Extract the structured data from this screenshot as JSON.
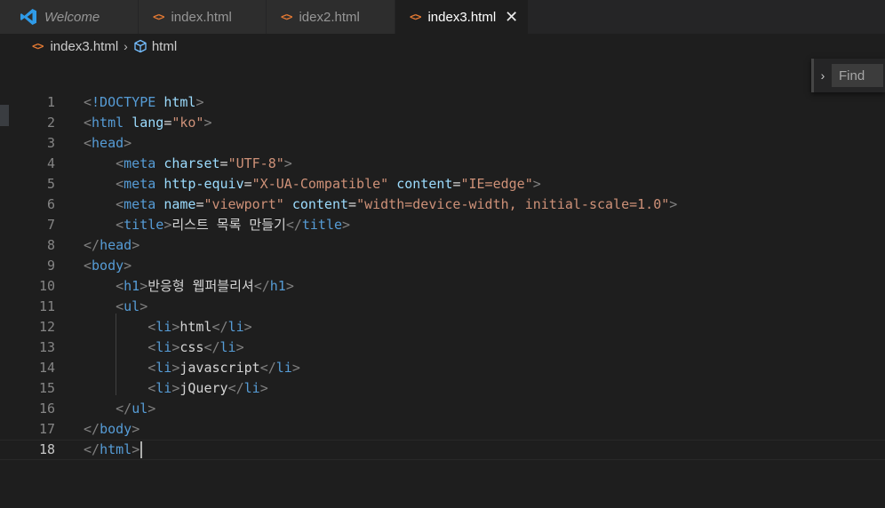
{
  "tabs": [
    {
      "label": "Welcome",
      "icon": "vscode-logo-icon",
      "italic": true,
      "active": false
    },
    {
      "label": "index.html",
      "icon": "html-file-icon",
      "active": false
    },
    {
      "label": "idex2.html",
      "icon": "html-file-icon",
      "active": false
    },
    {
      "label": "index3.html",
      "icon": "html-file-icon",
      "active": true,
      "close": "✕"
    }
  ],
  "breadcrumb": {
    "file": "index3.html",
    "separator": "›",
    "symbol": "html"
  },
  "find": {
    "chevron": "›",
    "placeholder": "Find"
  },
  "colors": {
    "editor_bg": "#1e1e1e",
    "tag": "#569cd6",
    "attribute": "#9cdcfe",
    "string": "#ce9178",
    "punctuation": "#808080",
    "text": "#d4d4d4",
    "line_number": "#858585",
    "html_icon": "#e37933",
    "vscode_blue": "#0078d4"
  },
  "editor": {
    "current_line": 18,
    "lines": [
      {
        "n": "1",
        "tokens": [
          [
            "pn",
            "<"
          ],
          [
            "tg",
            "!DOCTYPE "
          ],
          [
            "at",
            "html"
          ],
          [
            "pn",
            ">"
          ]
        ]
      },
      {
        "n": "2",
        "tokens": [
          [
            "pn",
            "<"
          ],
          [
            "tg",
            "html"
          ],
          [
            "tx",
            " "
          ],
          [
            "at",
            "lang"
          ],
          [
            "tx",
            "="
          ],
          [
            "st",
            "\"ko\""
          ],
          [
            "pn",
            ">"
          ]
        ]
      },
      {
        "n": "3",
        "tokens": [
          [
            "pn",
            "<"
          ],
          [
            "tg",
            "head"
          ],
          [
            "pn",
            ">"
          ]
        ]
      },
      {
        "n": "4",
        "tokens": [
          [
            "tx",
            "    "
          ],
          [
            "pn",
            "<"
          ],
          [
            "tg",
            "meta"
          ],
          [
            "tx",
            " "
          ],
          [
            "at",
            "charset"
          ],
          [
            "tx",
            "="
          ],
          [
            "st",
            "\"UTF-8\""
          ],
          [
            "pn",
            ">"
          ]
        ]
      },
      {
        "n": "5",
        "tokens": [
          [
            "tx",
            "    "
          ],
          [
            "pn",
            "<"
          ],
          [
            "tg",
            "meta"
          ],
          [
            "tx",
            " "
          ],
          [
            "at",
            "http-equiv"
          ],
          [
            "tx",
            "="
          ],
          [
            "st",
            "\"X-UA-Compatible\""
          ],
          [
            "tx",
            " "
          ],
          [
            "at",
            "content"
          ],
          [
            "tx",
            "="
          ],
          [
            "st",
            "\"IE=edge\""
          ],
          [
            "pn",
            ">"
          ]
        ]
      },
      {
        "n": "6",
        "tokens": [
          [
            "tx",
            "    "
          ],
          [
            "pn",
            "<"
          ],
          [
            "tg",
            "meta"
          ],
          [
            "tx",
            " "
          ],
          [
            "at",
            "name"
          ],
          [
            "tx",
            "="
          ],
          [
            "st",
            "\"viewport\""
          ],
          [
            "tx",
            " "
          ],
          [
            "at",
            "content"
          ],
          [
            "tx",
            "="
          ],
          [
            "st",
            "\"width=device-width, initial-scale=1.0\""
          ],
          [
            "pn",
            ">"
          ]
        ]
      },
      {
        "n": "7",
        "tokens": [
          [
            "tx",
            "    "
          ],
          [
            "pn",
            "<"
          ],
          [
            "tg",
            "title"
          ],
          [
            "pn",
            ">"
          ],
          [
            "tx",
            "리스트 목록 만들기"
          ],
          [
            "pn",
            "</"
          ],
          [
            "tg",
            "title"
          ],
          [
            "pn",
            ">"
          ]
        ]
      },
      {
        "n": "8",
        "tokens": [
          [
            "pn",
            "</"
          ],
          [
            "tg",
            "head"
          ],
          [
            "pn",
            ">"
          ]
        ]
      },
      {
        "n": "9",
        "tokens": [
          [
            "pn",
            "<"
          ],
          [
            "tg",
            "body"
          ],
          [
            "pn",
            ">"
          ]
        ]
      },
      {
        "n": "10",
        "tokens": [
          [
            "tx",
            "    "
          ],
          [
            "pn",
            "<"
          ],
          [
            "tg",
            "h1"
          ],
          [
            "pn",
            ">"
          ],
          [
            "tx",
            "반응형 웹퍼블리셔"
          ],
          [
            "pn",
            "</"
          ],
          [
            "tg",
            "h1"
          ],
          [
            "pn",
            ">"
          ]
        ]
      },
      {
        "n": "11",
        "tokens": [
          [
            "tx",
            "    "
          ],
          [
            "pn",
            "<"
          ],
          [
            "tg",
            "ul"
          ],
          [
            "pn",
            ">"
          ]
        ]
      },
      {
        "n": "12",
        "tokens": [
          [
            "tx",
            "        "
          ],
          [
            "pn",
            "<"
          ],
          [
            "tg",
            "li"
          ],
          [
            "pn",
            ">"
          ],
          [
            "tx",
            "html"
          ],
          [
            "pn",
            "</"
          ],
          [
            "tg",
            "li"
          ],
          [
            "pn",
            ">"
          ]
        ]
      },
      {
        "n": "13",
        "tokens": [
          [
            "tx",
            "        "
          ],
          [
            "pn",
            "<"
          ],
          [
            "tg",
            "li"
          ],
          [
            "pn",
            ">"
          ],
          [
            "tx",
            "css"
          ],
          [
            "pn",
            "</"
          ],
          [
            "tg",
            "li"
          ],
          [
            "pn",
            ">"
          ]
        ]
      },
      {
        "n": "14",
        "tokens": [
          [
            "tx",
            "        "
          ],
          [
            "pn",
            "<"
          ],
          [
            "tg",
            "li"
          ],
          [
            "pn",
            ">"
          ],
          [
            "tx",
            "javascript"
          ],
          [
            "pn",
            "</"
          ],
          [
            "tg",
            "li"
          ],
          [
            "pn",
            ">"
          ]
        ]
      },
      {
        "n": "15",
        "tokens": [
          [
            "tx",
            "        "
          ],
          [
            "pn",
            "<"
          ],
          [
            "tg",
            "li"
          ],
          [
            "pn",
            ">"
          ],
          [
            "tx",
            "jQuery"
          ],
          [
            "pn",
            "</"
          ],
          [
            "tg",
            "li"
          ],
          [
            "pn",
            ">"
          ]
        ]
      },
      {
        "n": "16",
        "tokens": [
          [
            "tx",
            "    "
          ],
          [
            "pn",
            "</"
          ],
          [
            "tg",
            "ul"
          ],
          [
            "pn",
            ">"
          ]
        ]
      },
      {
        "n": "17",
        "tokens": [
          [
            "pn",
            "</"
          ],
          [
            "tg",
            "body"
          ],
          [
            "pn",
            ">"
          ]
        ]
      },
      {
        "n": "18",
        "tokens": [
          [
            "pn",
            "</"
          ],
          [
            "tg",
            "html"
          ],
          [
            "pn",
            ">"
          ]
        ]
      }
    ]
  }
}
